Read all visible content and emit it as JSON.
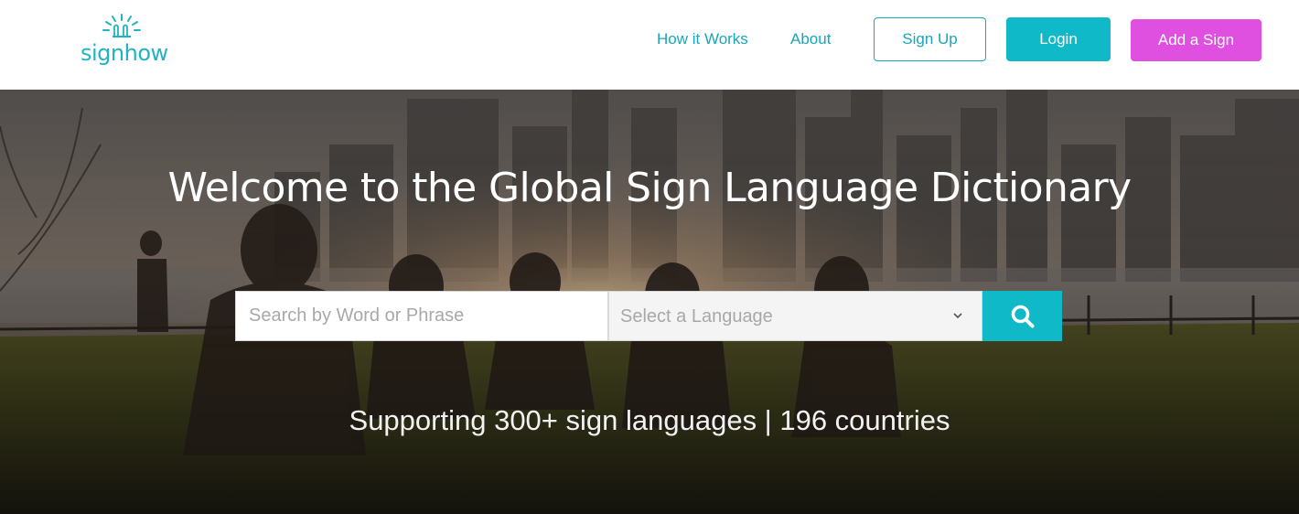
{
  "brand": {
    "name": "signhow",
    "logo_icon": "sunburst-hands-icon",
    "accent_color": "#10b9c8",
    "highlight_color": "#df4fe0"
  },
  "nav": {
    "how_it_works": "How it Works",
    "about": "About",
    "sign_up": "Sign Up",
    "login": "Login",
    "add_sign": "Add a Sign"
  },
  "hero": {
    "title": "Welcome to the Global Sign Language Dictionary",
    "tagline": "Supporting 300+ sign languages | 196 countries",
    "background": "photo of people sitting on grass by a river with a city skyline at sunset"
  },
  "search": {
    "placeholder": "Search by Word or Phrase",
    "value": "",
    "language_placeholder": "Select a Language",
    "button_icon": "search-icon"
  }
}
